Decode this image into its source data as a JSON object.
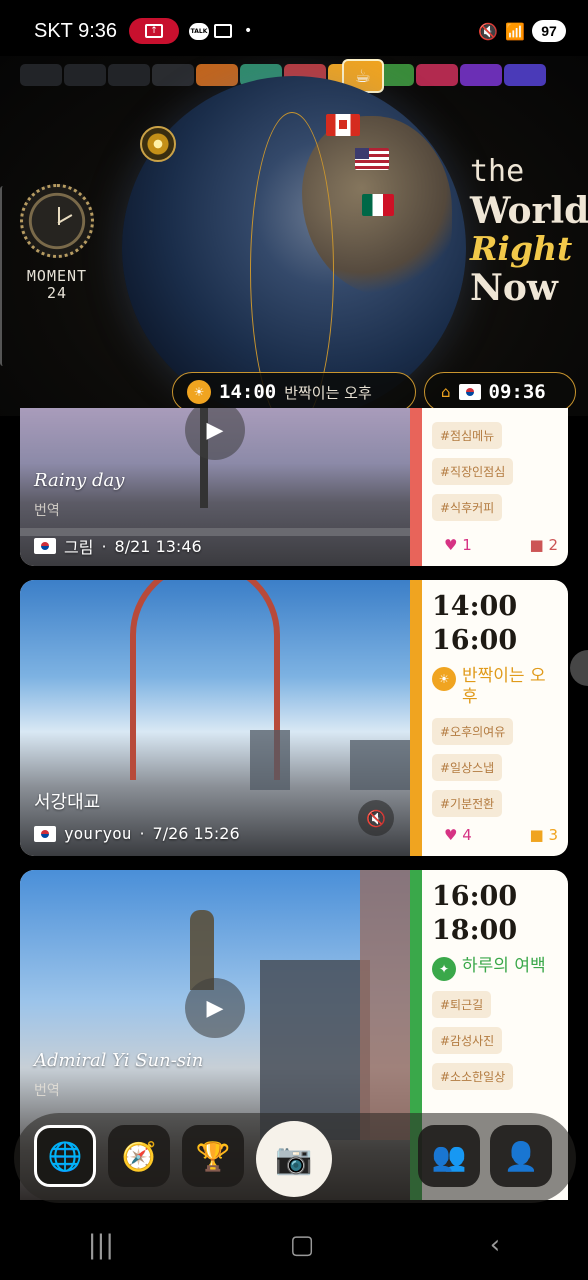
{
  "status": {
    "time": "SKT 9:36",
    "battery": "97",
    "talk": "TALK"
  },
  "header": {
    "brand_line1": "MOMENT",
    "brand_line2": "24",
    "headline": {
      "l1": "the",
      "l2": "World",
      "l3": "Right",
      "l4": "Now"
    },
    "current_time": "14:00",
    "current_label": "반짝이는 오후",
    "home_time": "09:36",
    "swatch_colors": [
      "#222428",
      "#222428",
      "#222428",
      "#2a2c30",
      "#c2651d",
      "#2e8b6a",
      "#b8393c",
      "#f0a420",
      "#3a8c3a",
      "#b22a4f",
      "#6b2fb5",
      "#4a3ab8"
    ]
  },
  "cards": [
    {
      "title": "Rainy day",
      "subtitle": "번역",
      "user": "그림",
      "date": "8/21 13:46",
      "accent": "#e8645a",
      "tags": [
        "#점심메뉴",
        "#직장인점심",
        "#식후커피"
      ],
      "likes": "1",
      "comments": "2"
    },
    {
      "title": "서강대교",
      "user": "youryou",
      "date": "7/26 15:26",
      "accent": "#f0a420",
      "range_start": "14:00",
      "range_end": "16:00",
      "slot_label": "반짝이는 오후",
      "tags": [
        "#오후의여유",
        "#일상스냅",
        "#기분전환"
      ],
      "likes": "4",
      "comments": "3"
    },
    {
      "title": "Admiral Yi Sun-sin",
      "subtitle": "번역",
      "accent": "#3aa84a",
      "range_start": "16:00",
      "range_end": "18:00",
      "slot_label": "하루의 여백",
      "tags": [
        "#퇴근길",
        "#감성사진",
        "#소소한일상"
      ]
    }
  ],
  "nav": {
    "items": [
      "globe-icon",
      "compass-icon",
      "trophy-icon",
      "camera-icon",
      "friends-icon",
      "profile-icon"
    ]
  }
}
